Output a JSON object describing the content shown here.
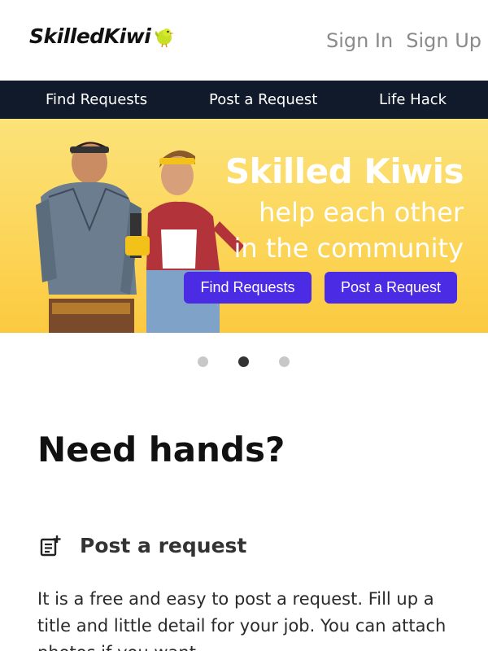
{
  "header": {
    "logo_text": "SkilledKiwi",
    "sign_in": "Sign In",
    "sign_up": "Sign Up"
  },
  "nav": {
    "items": [
      "Find Requests",
      "Post a Request",
      "Life Hack"
    ]
  },
  "hero": {
    "title": "Skilled Kiwis",
    "subtitle_line1": "help each other",
    "subtitle_line2": "in the community",
    "buttons": {
      "find": "Find Requests",
      "post": "Post a Request"
    },
    "colors": {
      "banner_top": "#fbe27a",
      "banner_bottom": "#fbc93f",
      "button": "#4b2be3"
    }
  },
  "carousel": {
    "slides": 3,
    "active_index": 1
  },
  "content": {
    "heading": "Need hands?",
    "section": {
      "icon": "post-request-icon",
      "title": "Post a request",
      "body": "It is a free and easy to post a request. Fill up a title and little detail for your job. You can attach photos if you want."
    }
  },
  "colors": {
    "nav_bg": "#111a2b",
    "auth_text": "#8a8a8a"
  }
}
